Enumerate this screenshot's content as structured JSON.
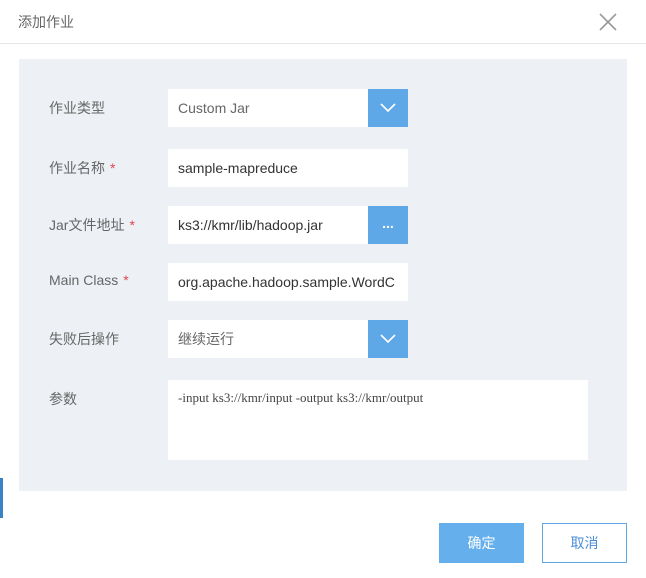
{
  "dialog": {
    "title": "添加作业",
    "close_icon": "close-icon"
  },
  "form": {
    "job_type": {
      "label": "作业类型",
      "value": "Custom Jar",
      "required": false
    },
    "job_name": {
      "label": "作业名称",
      "value": "sample-mapreduce",
      "required": true,
      "required_mark": "*"
    },
    "jar_path": {
      "label": "Jar文件地址",
      "value": "ks3://kmr/lib/hadoop.jar",
      "required": true,
      "required_mark": "*",
      "browse_label": "..."
    },
    "main_class": {
      "label": "Main Class",
      "value": "org.apache.hadoop.sample.WordC",
      "required": true,
      "required_mark": "*"
    },
    "on_failure": {
      "label": "失败后操作",
      "value": "继续运行",
      "required": false
    },
    "params": {
      "label": "参数",
      "value": "-input ks3://kmr/input -output ks3://kmr/output"
    }
  },
  "footer": {
    "confirm_label": "确定",
    "cancel_label": "取消"
  },
  "colors": {
    "accent": "#5fa8e8",
    "panel_bg": "#edf1f6",
    "required": "#e0474f"
  }
}
